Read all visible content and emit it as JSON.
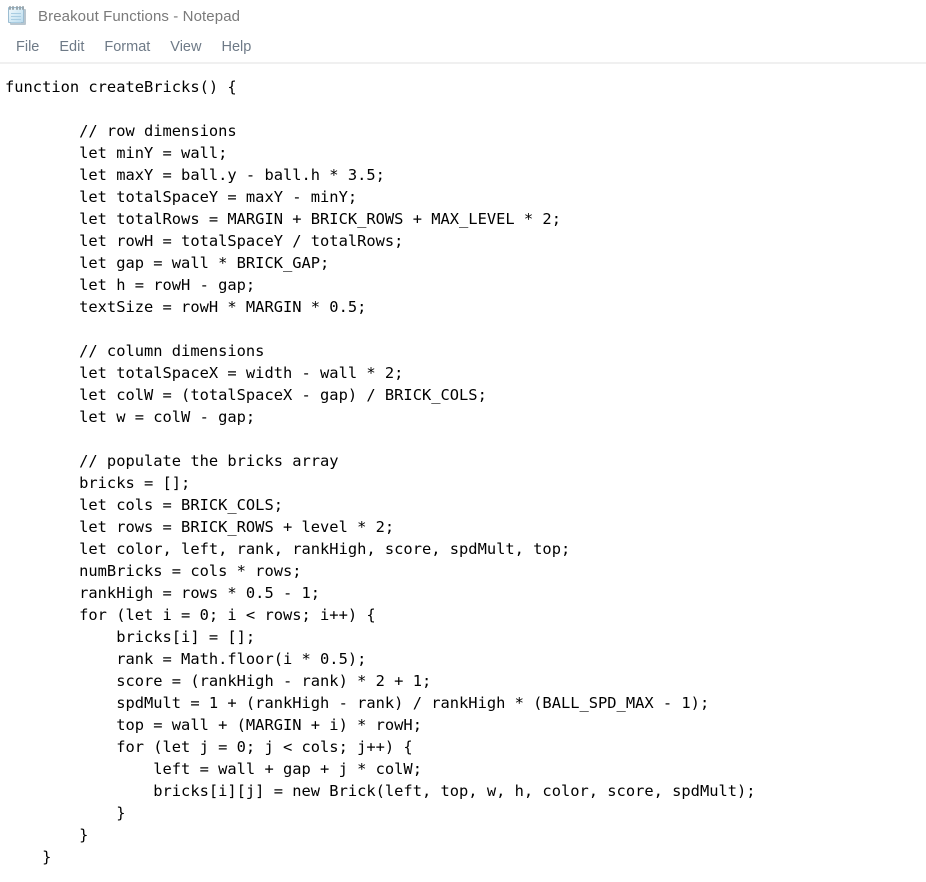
{
  "window": {
    "title": "Breakout Functions - Notepad",
    "icon": "notepad-icon",
    "app": "Notepad"
  },
  "menu": {
    "items": [
      {
        "label": "File"
      },
      {
        "label": "Edit"
      },
      {
        "label": "Format"
      },
      {
        "label": "View"
      },
      {
        "label": "Help"
      }
    ]
  },
  "editor": {
    "document_name": "Breakout Functions",
    "language": "javascript",
    "text": "function createBricks() {\n\n        // row dimensions\n        let minY = wall;\n        let maxY = ball.y - ball.h * 3.5;\n        let totalSpaceY = maxY - minY;\n        let totalRows = MARGIN + BRICK_ROWS + MAX_LEVEL * 2;\n        let rowH = totalSpaceY / totalRows;\n        let gap = wall * BRICK_GAP;\n        let h = rowH - gap;\n        textSize = rowH * MARGIN * 0.5;\n\n        // column dimensions\n        let totalSpaceX = width - wall * 2;\n        let colW = (totalSpaceX - gap) / BRICK_COLS;\n        let w = colW - gap;\n\n        // populate the bricks array\n        bricks = [];\n        let cols = BRICK_COLS;\n        let rows = BRICK_ROWS + level * 2;\n        let color, left, rank, rankHigh, score, spdMult, top;\n        numBricks = cols * rows;\n        rankHigh = rows * 0.5 - 1;\n        for (let i = 0; i < rows; i++) {\n            bricks[i] = [];\n            rank = Math.floor(i * 0.5);\n            score = (rankHigh - rank) * 2 + 1;\n            spdMult = 1 + (rankHigh - rank) / rankHigh * (BALL_SPD_MAX - 1);\n            top = wall + (MARGIN + i) * rowH;\n            for (let j = 0; j < cols; j++) {\n                left = wall + gap + j * colW;\n                bricks[i][j] = new Brick(left, top, w, h, color, score, spdMult);\n            }\n        }\n    }"
  },
  "colors": {
    "background": "#ffffff",
    "title_text": "#7a7a7a",
    "menu_text": "#6e7a87",
    "code_text": "#000000",
    "divider": "#f0f0f0",
    "icon_accent": "#bcdcee"
  }
}
